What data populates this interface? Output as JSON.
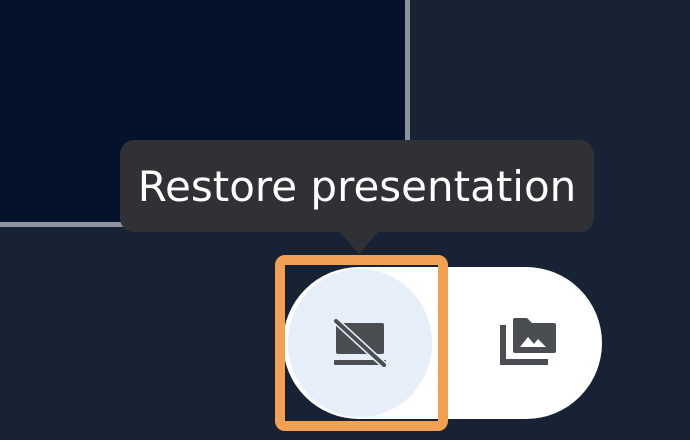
{
  "tooltip": {
    "text": "Restore presentation"
  },
  "controls": {
    "restore_icon": "presentation-off-icon",
    "media_icon": "photo-library-icon"
  },
  "colors": {
    "background": "#182235",
    "presentation_panel": "#04122b",
    "panel_border": "#8d939e",
    "tooltip_bg": "#2f3135",
    "selected_button": "#e5eef9",
    "focus_outline": "#f2a154",
    "icon": "#4a4d52"
  }
}
